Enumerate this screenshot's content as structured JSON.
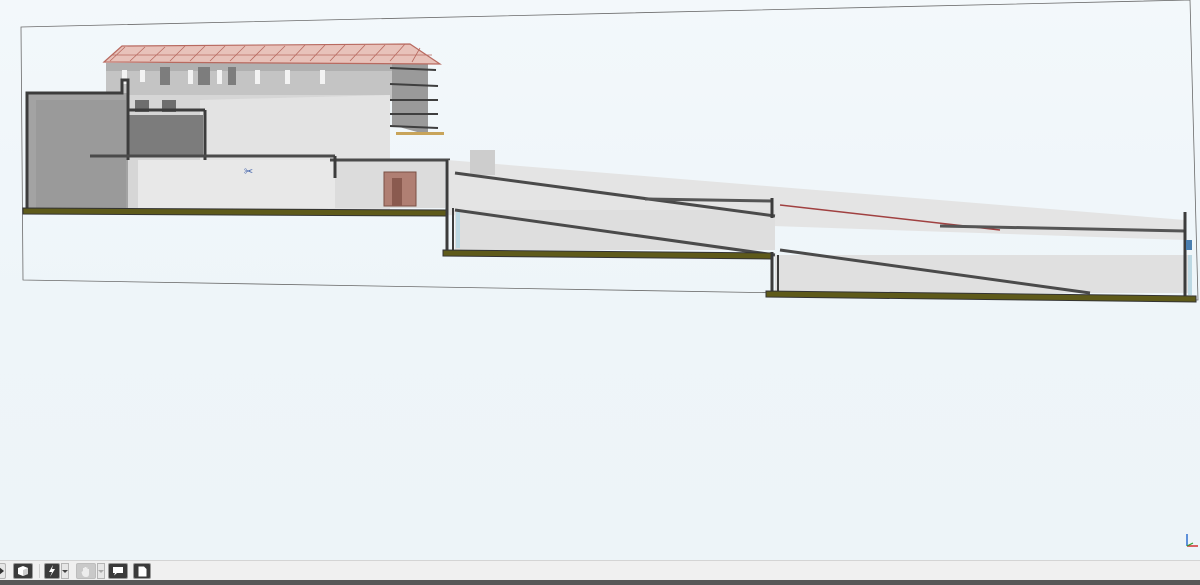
{
  "app": {
    "view": "3d-section-view"
  },
  "colors": {
    "viewport_bg": "#eef5f9",
    "roof": "#d9a39a",
    "floor_slab": "#5e5a1a",
    "wall_section": "#3c3c3c",
    "door": "#9c6b5e",
    "statusbar_bg": "#f0f0f0"
  },
  "statusbar": {
    "buttons": [
      {
        "name": "nav-arrow-button",
        "icon": "play-arrow-icon",
        "enabled": true
      },
      {
        "name": "view-cube-button",
        "icon": "cube-icon",
        "enabled": true
      },
      {
        "name": "wheel-button",
        "icon": "lightning-icon",
        "enabled": true,
        "dropdown": true
      },
      {
        "name": "orbit-button",
        "icon": "hand-icon",
        "enabled": false,
        "dropdown": true
      },
      {
        "name": "comment-button",
        "icon": "speech-bubble-icon",
        "enabled": true
      },
      {
        "name": "sheet-button",
        "icon": "page-icon",
        "enabled": true
      }
    ]
  },
  "axis_indicator": {
    "icon": "axis-triad-icon"
  }
}
